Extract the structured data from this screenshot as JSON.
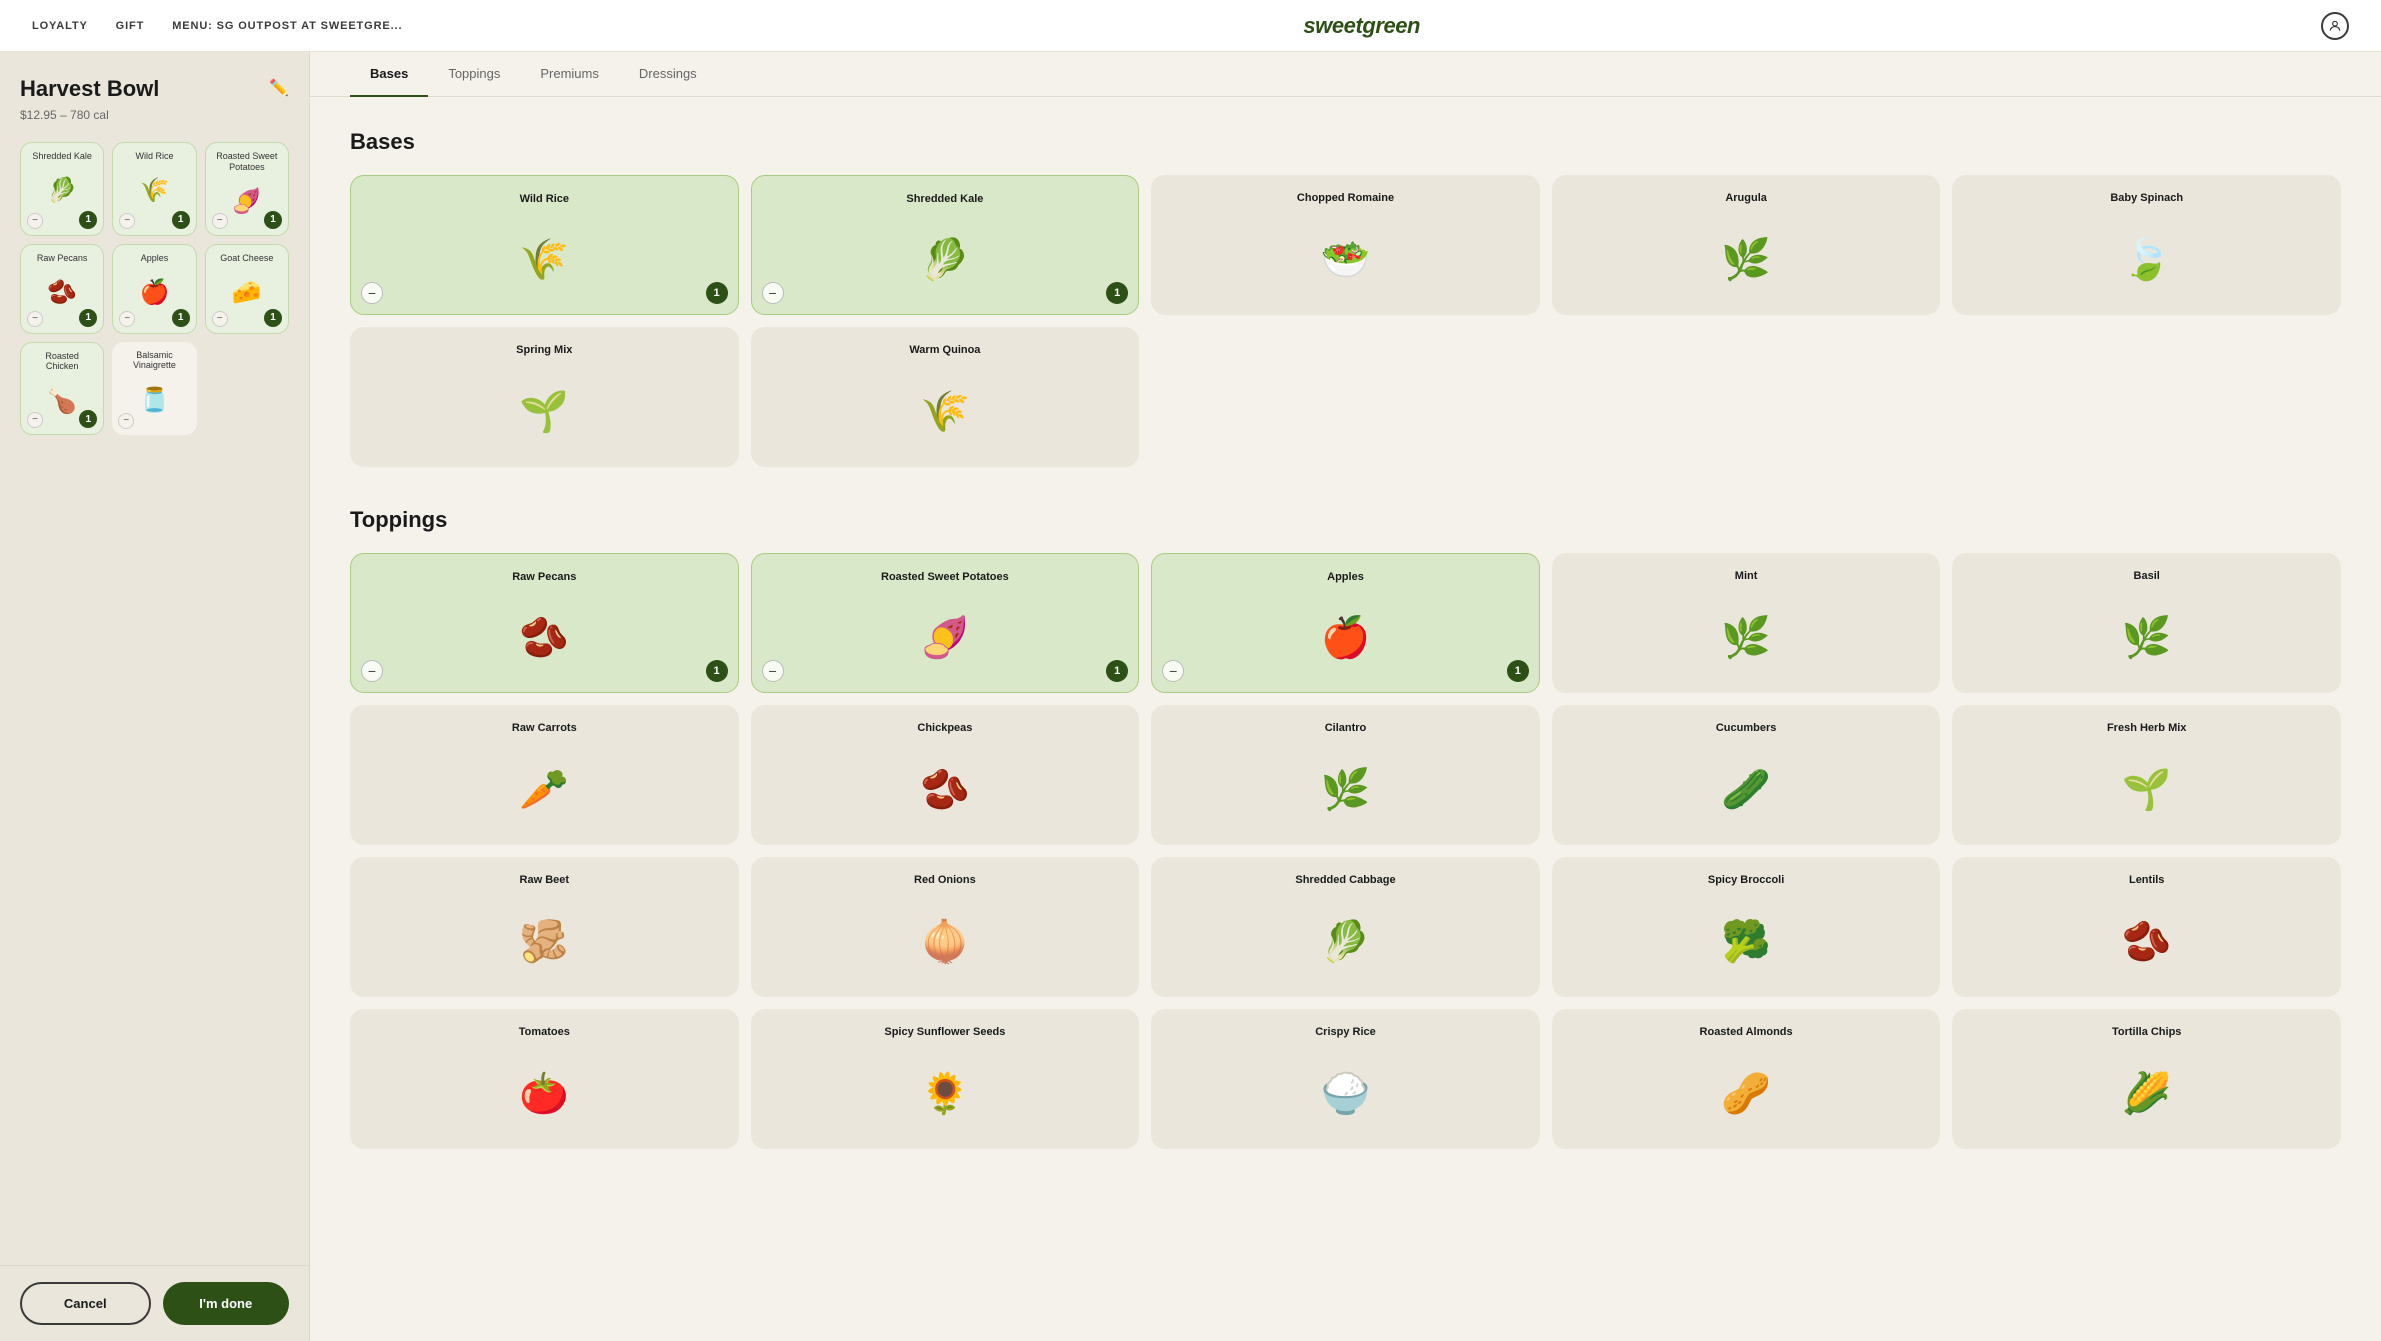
{
  "nav": {
    "links": [
      "LOYALTY",
      "GIFT",
      "MENU: SG OUTPOST AT SWEETGRE..."
    ],
    "logo": "sweetgreen"
  },
  "sidebar": {
    "title": "Harvest Bowl",
    "meta": "$12.95 – 780 cal",
    "items": [
      {
        "name": "Shredded Kale",
        "count": 1,
        "emoji": "🥬",
        "selected": true
      },
      {
        "name": "Wild Rice",
        "count": 1,
        "emoji": "🌾",
        "selected": true
      },
      {
        "name": "Roasted Sweet Potatoes",
        "count": 1,
        "emoji": "🍠",
        "selected": true
      },
      {
        "name": "Raw Pecans",
        "count": 1,
        "emoji": "🫘",
        "selected": true
      },
      {
        "name": "Apples",
        "count": 1,
        "emoji": "🍎",
        "selected": true
      },
      {
        "name": "Goat Cheese",
        "count": 1,
        "emoji": "🧀",
        "selected": true
      },
      {
        "name": "Roasted Chicken",
        "count": 1,
        "emoji": "🍗",
        "selected": true
      },
      {
        "name": "Balsamic Vinaigrette",
        "count": 0,
        "emoji": "🫙",
        "selected": false
      }
    ],
    "cancel_label": "Cancel",
    "done_label": "I'm done"
  },
  "tabs": [
    {
      "label": "Bases",
      "active": true
    },
    {
      "label": "Toppings",
      "active": false
    },
    {
      "label": "Premiums",
      "active": false
    },
    {
      "label": "Dressings",
      "active": false
    }
  ],
  "bases": {
    "heading": "Bases",
    "items": [
      {
        "name": "Wild Rice",
        "emoji": "🌾",
        "selected": true,
        "count": 1
      },
      {
        "name": "Shredded Kale",
        "emoji": "🥬",
        "selected": true,
        "count": 1
      },
      {
        "name": "Chopped Romaine",
        "emoji": "🥗",
        "selected": false,
        "count": 0
      },
      {
        "name": "Arugula",
        "emoji": "🌿",
        "selected": false,
        "count": 0
      },
      {
        "name": "Baby Spinach",
        "emoji": "🍃",
        "selected": false,
        "count": 0
      },
      {
        "name": "Spring Mix",
        "emoji": "🌱",
        "selected": false,
        "count": 0
      },
      {
        "name": "Warm Quinoa",
        "emoji": "🌾",
        "selected": false,
        "count": 0
      }
    ]
  },
  "toppings": {
    "heading": "Toppings",
    "items": [
      {
        "name": "Raw Pecans",
        "emoji": "🫘",
        "selected": true,
        "count": 1
      },
      {
        "name": "Roasted Sweet Potatoes",
        "emoji": "🍠",
        "selected": true,
        "count": 1
      },
      {
        "name": "Apples",
        "emoji": "🍎",
        "selected": true,
        "count": 1
      },
      {
        "name": "Mint",
        "emoji": "🌿",
        "selected": false,
        "count": 0
      },
      {
        "name": "Basil",
        "emoji": "🌿",
        "selected": false,
        "count": 0
      },
      {
        "name": "Raw Carrots",
        "emoji": "🥕",
        "selected": false,
        "count": 0
      },
      {
        "name": "Chickpeas",
        "emoji": "🫘",
        "selected": false,
        "count": 0
      },
      {
        "name": "Cilantro",
        "emoji": "🌿",
        "selected": false,
        "count": 0
      },
      {
        "name": "Cucumbers",
        "emoji": "🥒",
        "selected": false,
        "count": 0
      },
      {
        "name": "Fresh Herb Mix",
        "emoji": "🌱",
        "selected": false,
        "count": 0
      },
      {
        "name": "Raw Beet",
        "emoji": "🫚",
        "selected": false,
        "count": 0
      },
      {
        "name": "Red Onions",
        "emoji": "🧅",
        "selected": false,
        "count": 0
      },
      {
        "name": "Shredded Cabbage",
        "emoji": "🥬",
        "selected": false,
        "count": 0
      },
      {
        "name": "Spicy Broccoli",
        "emoji": "🥦",
        "selected": false,
        "count": 0
      },
      {
        "name": "Lentils",
        "emoji": "🫘",
        "selected": false,
        "count": 0
      },
      {
        "name": "Tomatoes",
        "emoji": "🍅",
        "selected": false,
        "count": 0
      },
      {
        "name": "Spicy Sunflower Seeds",
        "emoji": "🌻",
        "selected": false,
        "count": 0
      },
      {
        "name": "Crispy Rice",
        "emoji": "🍚",
        "selected": false,
        "count": 0
      },
      {
        "name": "Roasted Almonds",
        "emoji": "🥜",
        "selected": false,
        "count": 0
      },
      {
        "name": "Tortilla Chips",
        "emoji": "🌽",
        "selected": false,
        "count": 0
      }
    ]
  }
}
